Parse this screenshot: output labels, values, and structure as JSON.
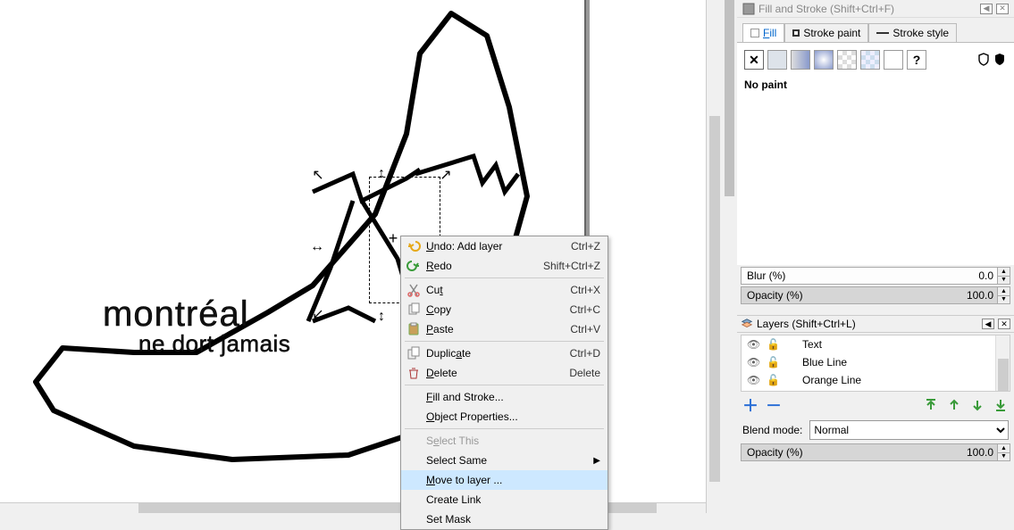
{
  "fillStroke": {
    "title": "Fill and Stroke (Shift+Ctrl+F)",
    "tabs": {
      "fill": "Fill",
      "strokePaint": "Stroke paint",
      "strokeStyle": "Stroke style"
    },
    "noPaint": "No paint",
    "blurLabel": "Blur (%)",
    "blurValue": "0.0",
    "opacityLabel": "Opacity (%)",
    "opacityValue": "100.0"
  },
  "layers": {
    "title": "Layers (Shift+Ctrl+L)",
    "items": [
      {
        "name": "Text"
      },
      {
        "name": "Blue Line"
      },
      {
        "name": "Orange Line"
      }
    ],
    "blendLabel": "Blend mode:",
    "blendValue": "Normal",
    "opacityLabel": "Opacity (%)",
    "opacityValue": "100.0"
  },
  "canvasText": {
    "line1": "montréal",
    "line2": "ne dort jamais"
  },
  "context": {
    "undo": {
      "label": "Undo: Add layer",
      "shortcut": "Ctrl+Z"
    },
    "redo": {
      "label": "Redo",
      "shortcut": "Shift+Ctrl+Z"
    },
    "cut": {
      "label": "Cut",
      "shortcut": "Ctrl+X"
    },
    "copy": {
      "label": "Copy",
      "shortcut": "Ctrl+C"
    },
    "paste": {
      "label": "Paste",
      "shortcut": "Ctrl+V"
    },
    "duplicate": {
      "label": "Duplicate",
      "shortcut": "Ctrl+D"
    },
    "delete": {
      "label": "Delete",
      "shortcut": "Delete"
    },
    "fillStroke": "Fill and Stroke...",
    "objProps": "Object Properties...",
    "selectThis": "Select This",
    "selectSame": "Select Same",
    "moveToLayer": "Move to layer ...",
    "createLink": "Create Link",
    "setMask": "Set Mask"
  }
}
